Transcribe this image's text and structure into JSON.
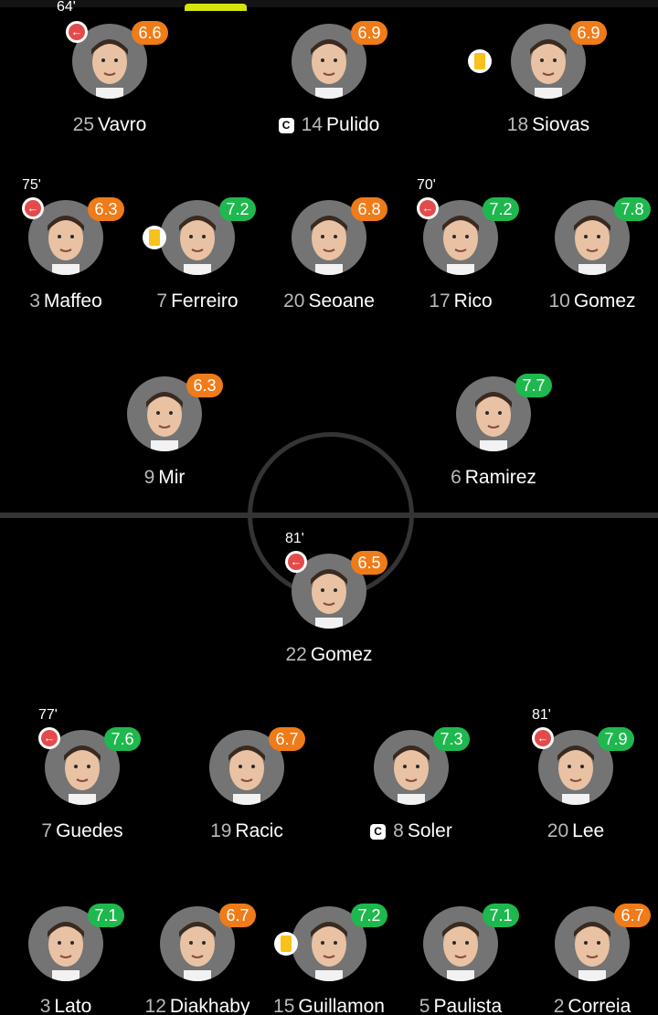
{
  "icons": {
    "sub_out": "arrow-left-icon",
    "yellow_card": "yellow-card-icon",
    "captain": "captain-badge-icon"
  },
  "colors": {
    "background": "#000000",
    "pitch_lines": "#343434",
    "rating_green": "#1fb84e",
    "rating_orange": "#ef7b19",
    "avatar_bg": "#747474",
    "sub_out": "#e34a4a",
    "yellow_card": "#f6c21b",
    "tab_indicator": "#d6e40e"
  },
  "home": {
    "defenders": [
      {
        "number": "25",
        "name": "Vavro",
        "rating": "6.6",
        "minute": "64'",
        "captain_label": "",
        "rating_color": "orange"
      },
      {
        "number": "14",
        "name": "Pulido",
        "rating": "6.9",
        "minute": "",
        "captain_label": "C",
        "rating_color": "orange"
      },
      {
        "number": "18",
        "name": "Siovas",
        "rating": "6.9",
        "minute": "",
        "captain_label": "",
        "rating_color": "orange"
      }
    ],
    "midfielders": [
      {
        "number": "3",
        "name": "Maffeo",
        "rating": "6.3",
        "minute": "75'",
        "rating_color": "orange"
      },
      {
        "number": "7",
        "name": "Ferreiro",
        "rating": "7.2",
        "minute": "",
        "rating_color": "green"
      },
      {
        "number": "20",
        "name": "Seoane",
        "rating": "6.8",
        "minute": "",
        "rating_color": "orange"
      },
      {
        "number": "17",
        "name": "Rico",
        "rating": "7.2",
        "minute": "70'",
        "rating_color": "green"
      },
      {
        "number": "10",
        "name": "Gomez",
        "rating": "7.8",
        "minute": "",
        "rating_color": "green"
      }
    ],
    "forwards": [
      {
        "number": "9",
        "name": "Mir",
        "rating": "6.3",
        "rating_color": "orange"
      },
      {
        "number": "6",
        "name": "Ramirez",
        "rating": "7.7",
        "rating_color": "green"
      }
    ]
  },
  "away": {
    "forwards": [
      {
        "number": "22",
        "name": "Gomez",
        "rating": "6.5",
        "minute": "81'",
        "rating_color": "orange"
      }
    ],
    "midfielders": [
      {
        "number": "7",
        "name": "Guedes",
        "rating": "7.6",
        "minute": "77'",
        "captain_label": "",
        "rating_color": "green"
      },
      {
        "number": "19",
        "name": "Racic",
        "rating": "6.7",
        "minute": "",
        "captain_label": "",
        "rating_color": "orange"
      },
      {
        "number": "8",
        "name": "Soler",
        "rating": "7.3",
        "minute": "",
        "captain_label": "C",
        "rating_color": "green"
      },
      {
        "number": "20",
        "name": "Lee",
        "rating": "7.9",
        "minute": "81'",
        "captain_label": "",
        "rating_color": "green"
      }
    ],
    "defenders": [
      {
        "number": "3",
        "name": "Lato",
        "rating": "7.1",
        "rating_color": "green"
      },
      {
        "number": "12",
        "name": "Diakhaby",
        "rating": "6.7",
        "rating_color": "orange"
      },
      {
        "number": "15",
        "name": "Guillamon",
        "rating": "7.2",
        "rating_color": "green"
      },
      {
        "number": "5",
        "name": "Paulista",
        "rating": "7.1",
        "rating_color": "green"
      },
      {
        "number": "2",
        "name": "Correia",
        "rating": "6.7",
        "rating_color": "orange"
      }
    ]
  }
}
